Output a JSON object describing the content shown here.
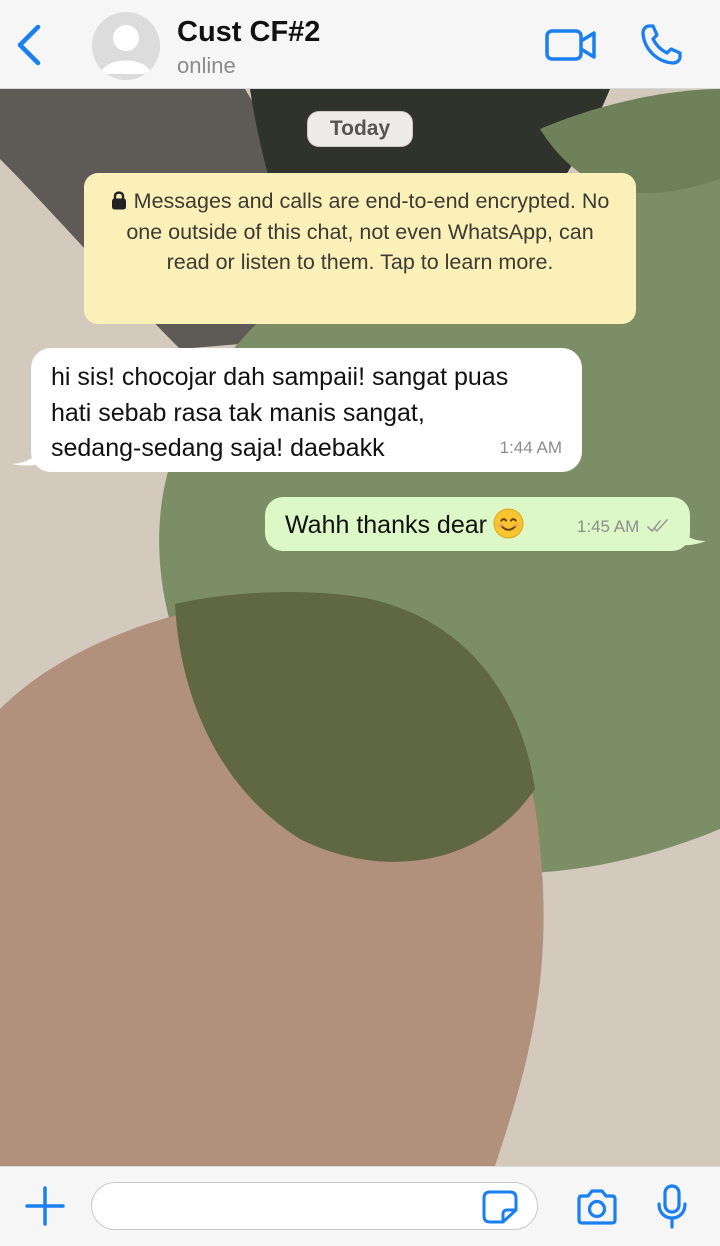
{
  "header": {
    "contact_name": "Cust CF#2",
    "status": "online"
  },
  "chat": {
    "date_label": "Today",
    "encryption_notice": "Messages and calls are end-to-end encrypted. No one outside of this chat, not even WhatsApp, can read or listen to them. Tap to learn more.",
    "messages": [
      {
        "direction": "incoming",
        "lines": [
          "hi sis! chocojar dah sampaii! sangat puas",
          "hati sebab rasa tak manis sangat,",
          "sedang-sedang saja! daebakk"
        ],
        "time": "1:44 AM"
      },
      {
        "direction": "outgoing",
        "text": "Wahh thanks dear",
        "emoji": "smiling-face-icon",
        "time": "1:45 AM",
        "status": "read"
      }
    ]
  },
  "footer": {
    "input_placeholder": ""
  },
  "colors": {
    "accent": "#1a7ff0",
    "outgoing_bubble": "#dcf8c6",
    "incoming_bubble": "#ffffff",
    "encryption_bg": "#fbf0b8"
  }
}
